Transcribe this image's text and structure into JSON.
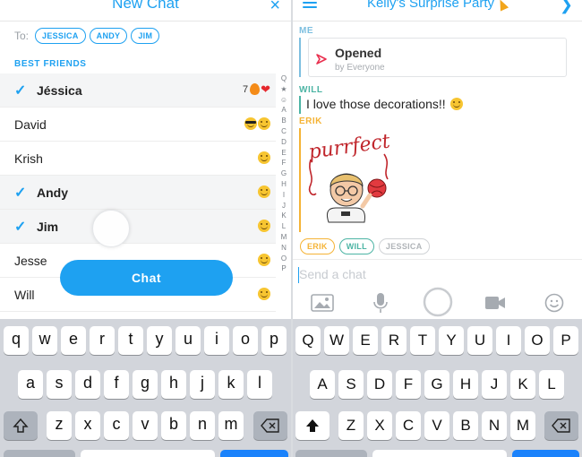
{
  "left": {
    "title": "New Chat",
    "close_icon": "×",
    "to_label": "To:",
    "recipients": [
      "JESSICA",
      "ANDY",
      "JIM"
    ],
    "section": "BEST FRIENDS",
    "friends": [
      {
        "name": "Jéssica",
        "selected": true,
        "emoji_count": "7"
      },
      {
        "name": "David",
        "selected": false
      },
      {
        "name": "Krish",
        "selected": false
      },
      {
        "name": "Andy",
        "selected": true
      },
      {
        "name": "Jim",
        "selected": true
      },
      {
        "name": "Jesse",
        "selected": false
      },
      {
        "name": "Will",
        "selected": false
      }
    ],
    "index": [
      "Q",
      "★",
      "☺",
      "A",
      "B",
      "C",
      "D",
      "E",
      "F",
      "G",
      "H",
      "I",
      "J",
      "K",
      "L",
      "M",
      "N",
      "O",
      "P"
    ],
    "chat_button": "Chat"
  },
  "right": {
    "title": "Kelly's Surprise Party",
    "me_label": "ME",
    "opened_title": "Opened",
    "opened_sub": "by Everyone",
    "will_label": "WILL",
    "will_message": "I love those decorations!!",
    "erik_label": "ERIK",
    "sticker_text": "purrfect",
    "chips": [
      {
        "label": "ERIK",
        "color": "#f5b335"
      },
      {
        "label": "WILL",
        "color": "#4cb4a4"
      },
      {
        "label": "JESSICA",
        "color": "#b0b4b8"
      }
    ],
    "compose_placeholder": "Send a chat"
  },
  "keyboard_left": {
    "row1": [
      "q",
      "w",
      "e",
      "r",
      "t",
      "y",
      "u",
      "i",
      "o",
      "p"
    ],
    "row2": [
      "a",
      "s",
      "d",
      "f",
      "g",
      "h",
      "j",
      "k",
      "l"
    ],
    "row3": [
      "z",
      "x",
      "c",
      "v",
      "b",
      "n",
      "m"
    ]
  },
  "keyboard_right": {
    "row1": [
      "Q",
      "W",
      "E",
      "R",
      "T",
      "Y",
      "U",
      "I",
      "O",
      "P"
    ],
    "row2": [
      "A",
      "S",
      "D",
      "F",
      "G",
      "H",
      "J",
      "K",
      "L"
    ],
    "row3": [
      "Z",
      "X",
      "C",
      "V",
      "B",
      "N",
      "M"
    ]
  },
  "colors": {
    "accent": "#1ea1f1",
    "me": "#7dbfe0",
    "will": "#4cb4a4",
    "erik": "#f5b335"
  },
  "icons": [
    "close-icon",
    "check-icon",
    "smile-emoji-icon",
    "sunglasses-emoji-icon",
    "fire-emoji-icon",
    "heart-emoji-icon",
    "hamburger-menu-icon",
    "chevron-right-icon",
    "party-popper-icon",
    "opened-arrow-icon",
    "image-icon",
    "microphone-icon",
    "capture-circle-icon",
    "video-call-icon",
    "sticker-smiley-icon",
    "shift-icon",
    "backspace-icon"
  ]
}
